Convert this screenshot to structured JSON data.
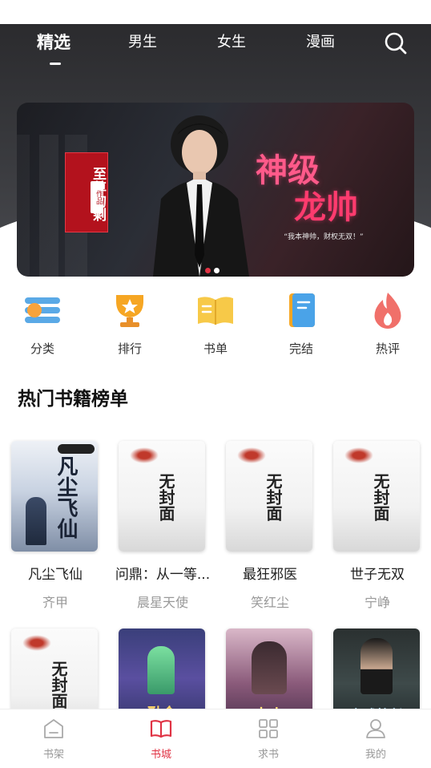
{
  "top_tabs": [
    {
      "label": "精选",
      "active": true
    },
    {
      "label": "男生",
      "active": false
    },
    {
      "label": "女生",
      "active": false
    },
    {
      "label": "漫画",
      "active": false
    }
  ],
  "banner": {
    "badge_text": "至尊狗剩",
    "badge_tag": "作品",
    "title_line1": "神级",
    "title_line2": "龙帅",
    "slogan": "“我本神帅，财权无双！”",
    "active_slide": 1,
    "slide_count": 2
  },
  "quick_entries": [
    {
      "label": "分类",
      "icon": "list-category-icon"
    },
    {
      "label": "排行",
      "icon": "trophy-icon"
    },
    {
      "label": "书单",
      "icon": "open-book-icon"
    },
    {
      "label": "完结",
      "icon": "notebook-icon"
    },
    {
      "label": "热评",
      "icon": "flame-icon"
    }
  ],
  "section_title": "热门书籍榜单",
  "books_row1": [
    {
      "title": "凡尘飞仙",
      "author": "齐甲",
      "cover_text": "凡尘飞仙"
    },
    {
      "title": "问鼎：从一等...",
      "author": "晨星天使",
      "cover_text": "无封面"
    },
    {
      "title": "最狂邪医",
      "author": "笑红尘",
      "cover_text": "无封面"
    },
    {
      "title": "世子无双",
      "author": "宁峥",
      "cover_text": "无封面"
    }
  ],
  "books_row2": [
    {
      "cover_text": "无封面"
    },
    {
      "cover_text": "融合"
    },
    {
      "cover_text": "史上"
    },
    {
      "cover_text": "高武校长"
    }
  ],
  "bottom_nav": [
    {
      "label": "书架",
      "icon": "bookshelf-icon",
      "active": false
    },
    {
      "label": "书城",
      "icon": "book-city-icon",
      "active": true
    },
    {
      "label": "求书",
      "icon": "grid-request-icon",
      "active": false
    },
    {
      "label": "我的",
      "icon": "user-profile-icon",
      "active": false
    }
  ],
  "colors": {
    "accent": "#e03344",
    "header_bg": "#2b2b2e",
    "inactive_text": "#999999"
  }
}
